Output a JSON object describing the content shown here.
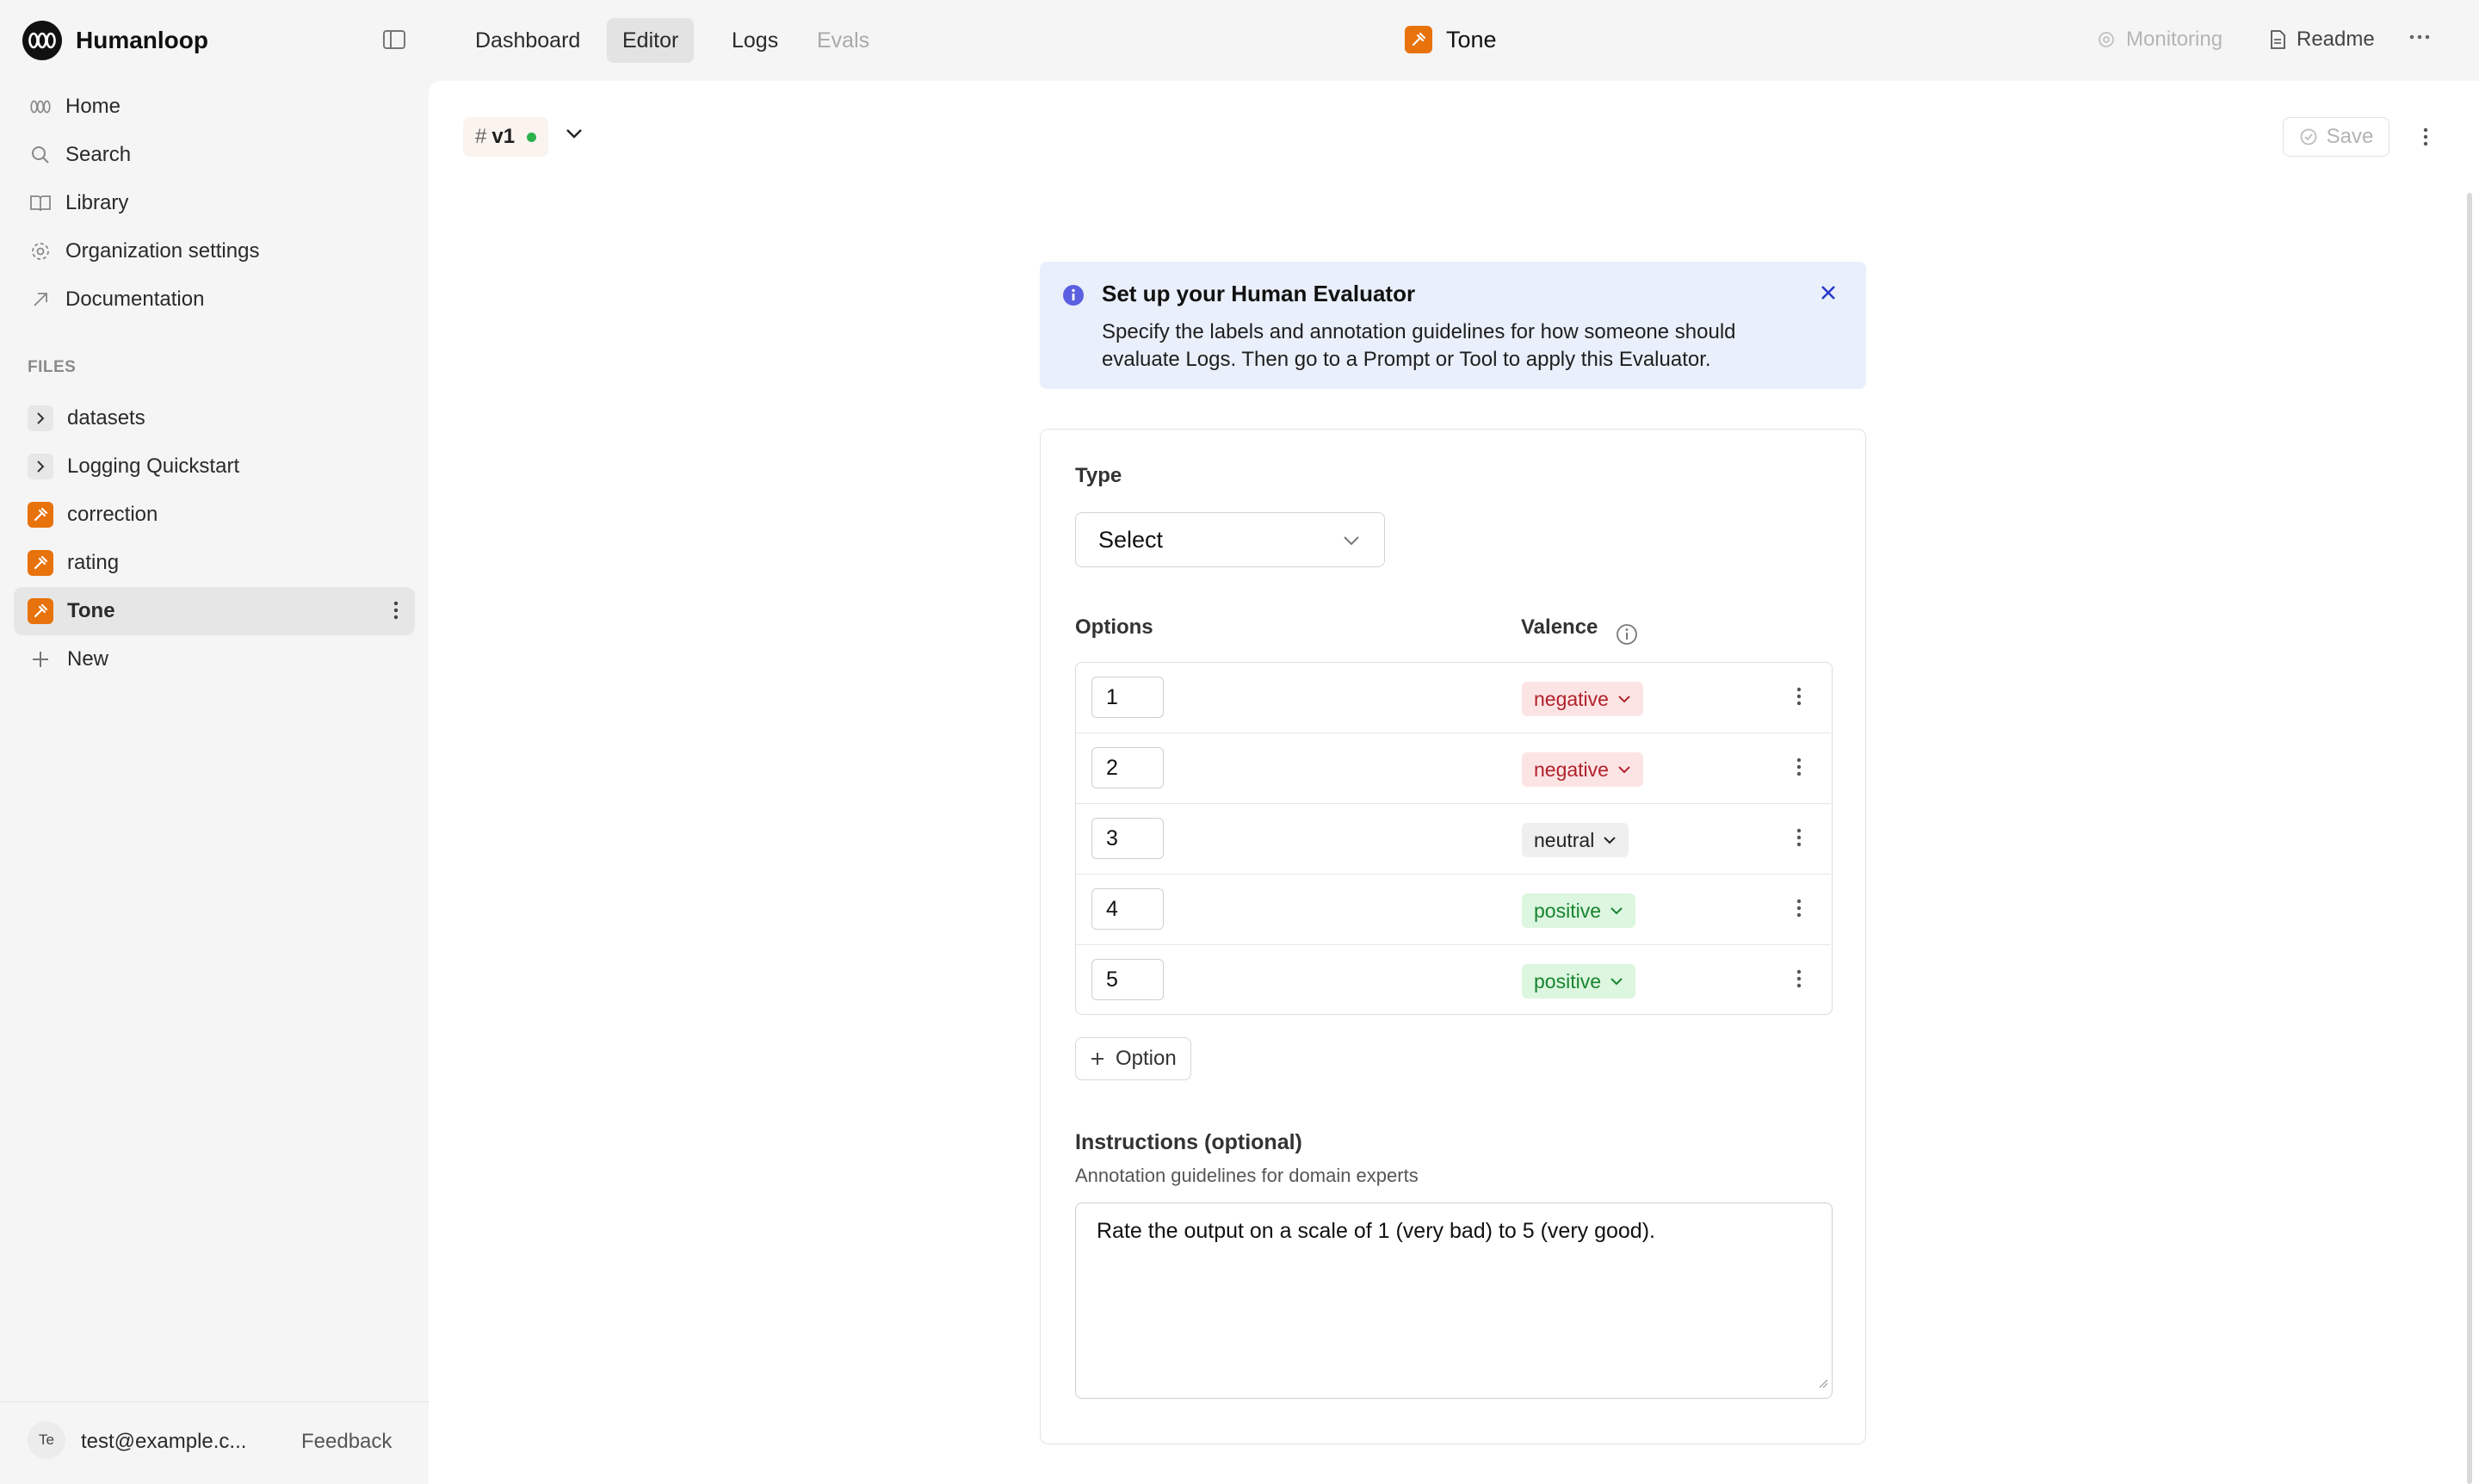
{
  "app": {
    "name": "Humanloop"
  },
  "sidebar": {
    "nav": [
      {
        "label": "Home",
        "icon": "home-icon"
      },
      {
        "label": "Search",
        "icon": "search-icon"
      },
      {
        "label": "Library",
        "icon": "book-icon"
      },
      {
        "label": "Organization settings",
        "icon": "gear-icon"
      },
      {
        "label": "Documentation",
        "icon": "external-arrow-icon"
      }
    ],
    "files_label": "FILES",
    "files": [
      {
        "label": "datasets",
        "kind": "folder"
      },
      {
        "label": "Logging Quickstart",
        "kind": "folder"
      },
      {
        "label": "correction",
        "kind": "evaluator"
      },
      {
        "label": "rating",
        "kind": "evaluator"
      },
      {
        "label": "Tone",
        "kind": "evaluator",
        "active": true
      }
    ],
    "new_label": "New",
    "footer": {
      "avatar": "Te",
      "email": "test@example.c...",
      "feedback": "Feedback"
    }
  },
  "topbar": {
    "tabs": [
      {
        "label": "Dashboard",
        "state": "normal"
      },
      {
        "label": "Editor",
        "state": "active"
      },
      {
        "label": "Logs",
        "state": "normal"
      },
      {
        "label": "Evals",
        "state": "disabled"
      }
    ],
    "title": "Tone",
    "monitoring": "Monitoring",
    "readme": "Readme"
  },
  "editor": {
    "version": {
      "hash": "#",
      "label": "v1",
      "status_color": "#2bb24c"
    },
    "save_label": "Save"
  },
  "banner": {
    "title": "Set up your Human Evaluator",
    "body": "Specify the labels and annotation guidelines for how someone should evaluate Logs. Then go to a Prompt or Tool to apply this Evaluator."
  },
  "form": {
    "type_label": "Type",
    "type_value": "Select",
    "options_label": "Options",
    "valence_label": "Valence",
    "options": [
      {
        "value": "1",
        "valence": "negative"
      },
      {
        "value": "2",
        "valence": "negative"
      },
      {
        "value": "3",
        "valence": "neutral"
      },
      {
        "value": "4",
        "valence": "positive"
      },
      {
        "value": "5",
        "valence": "positive"
      }
    ],
    "add_option_label": "Option",
    "instructions_label": "Instructions (optional)",
    "instructions_sub": "Annotation guidelines for domain experts",
    "instructions_value": "Rate the output on a scale of 1 (very bad) to 5 (very good)."
  },
  "colors": {
    "accent_orange": "#e8720c",
    "negative_bg": "#fde4e4",
    "neutral_bg": "#efefef",
    "positive_bg": "#dcf6df",
    "banner_bg": "#e9effb"
  }
}
